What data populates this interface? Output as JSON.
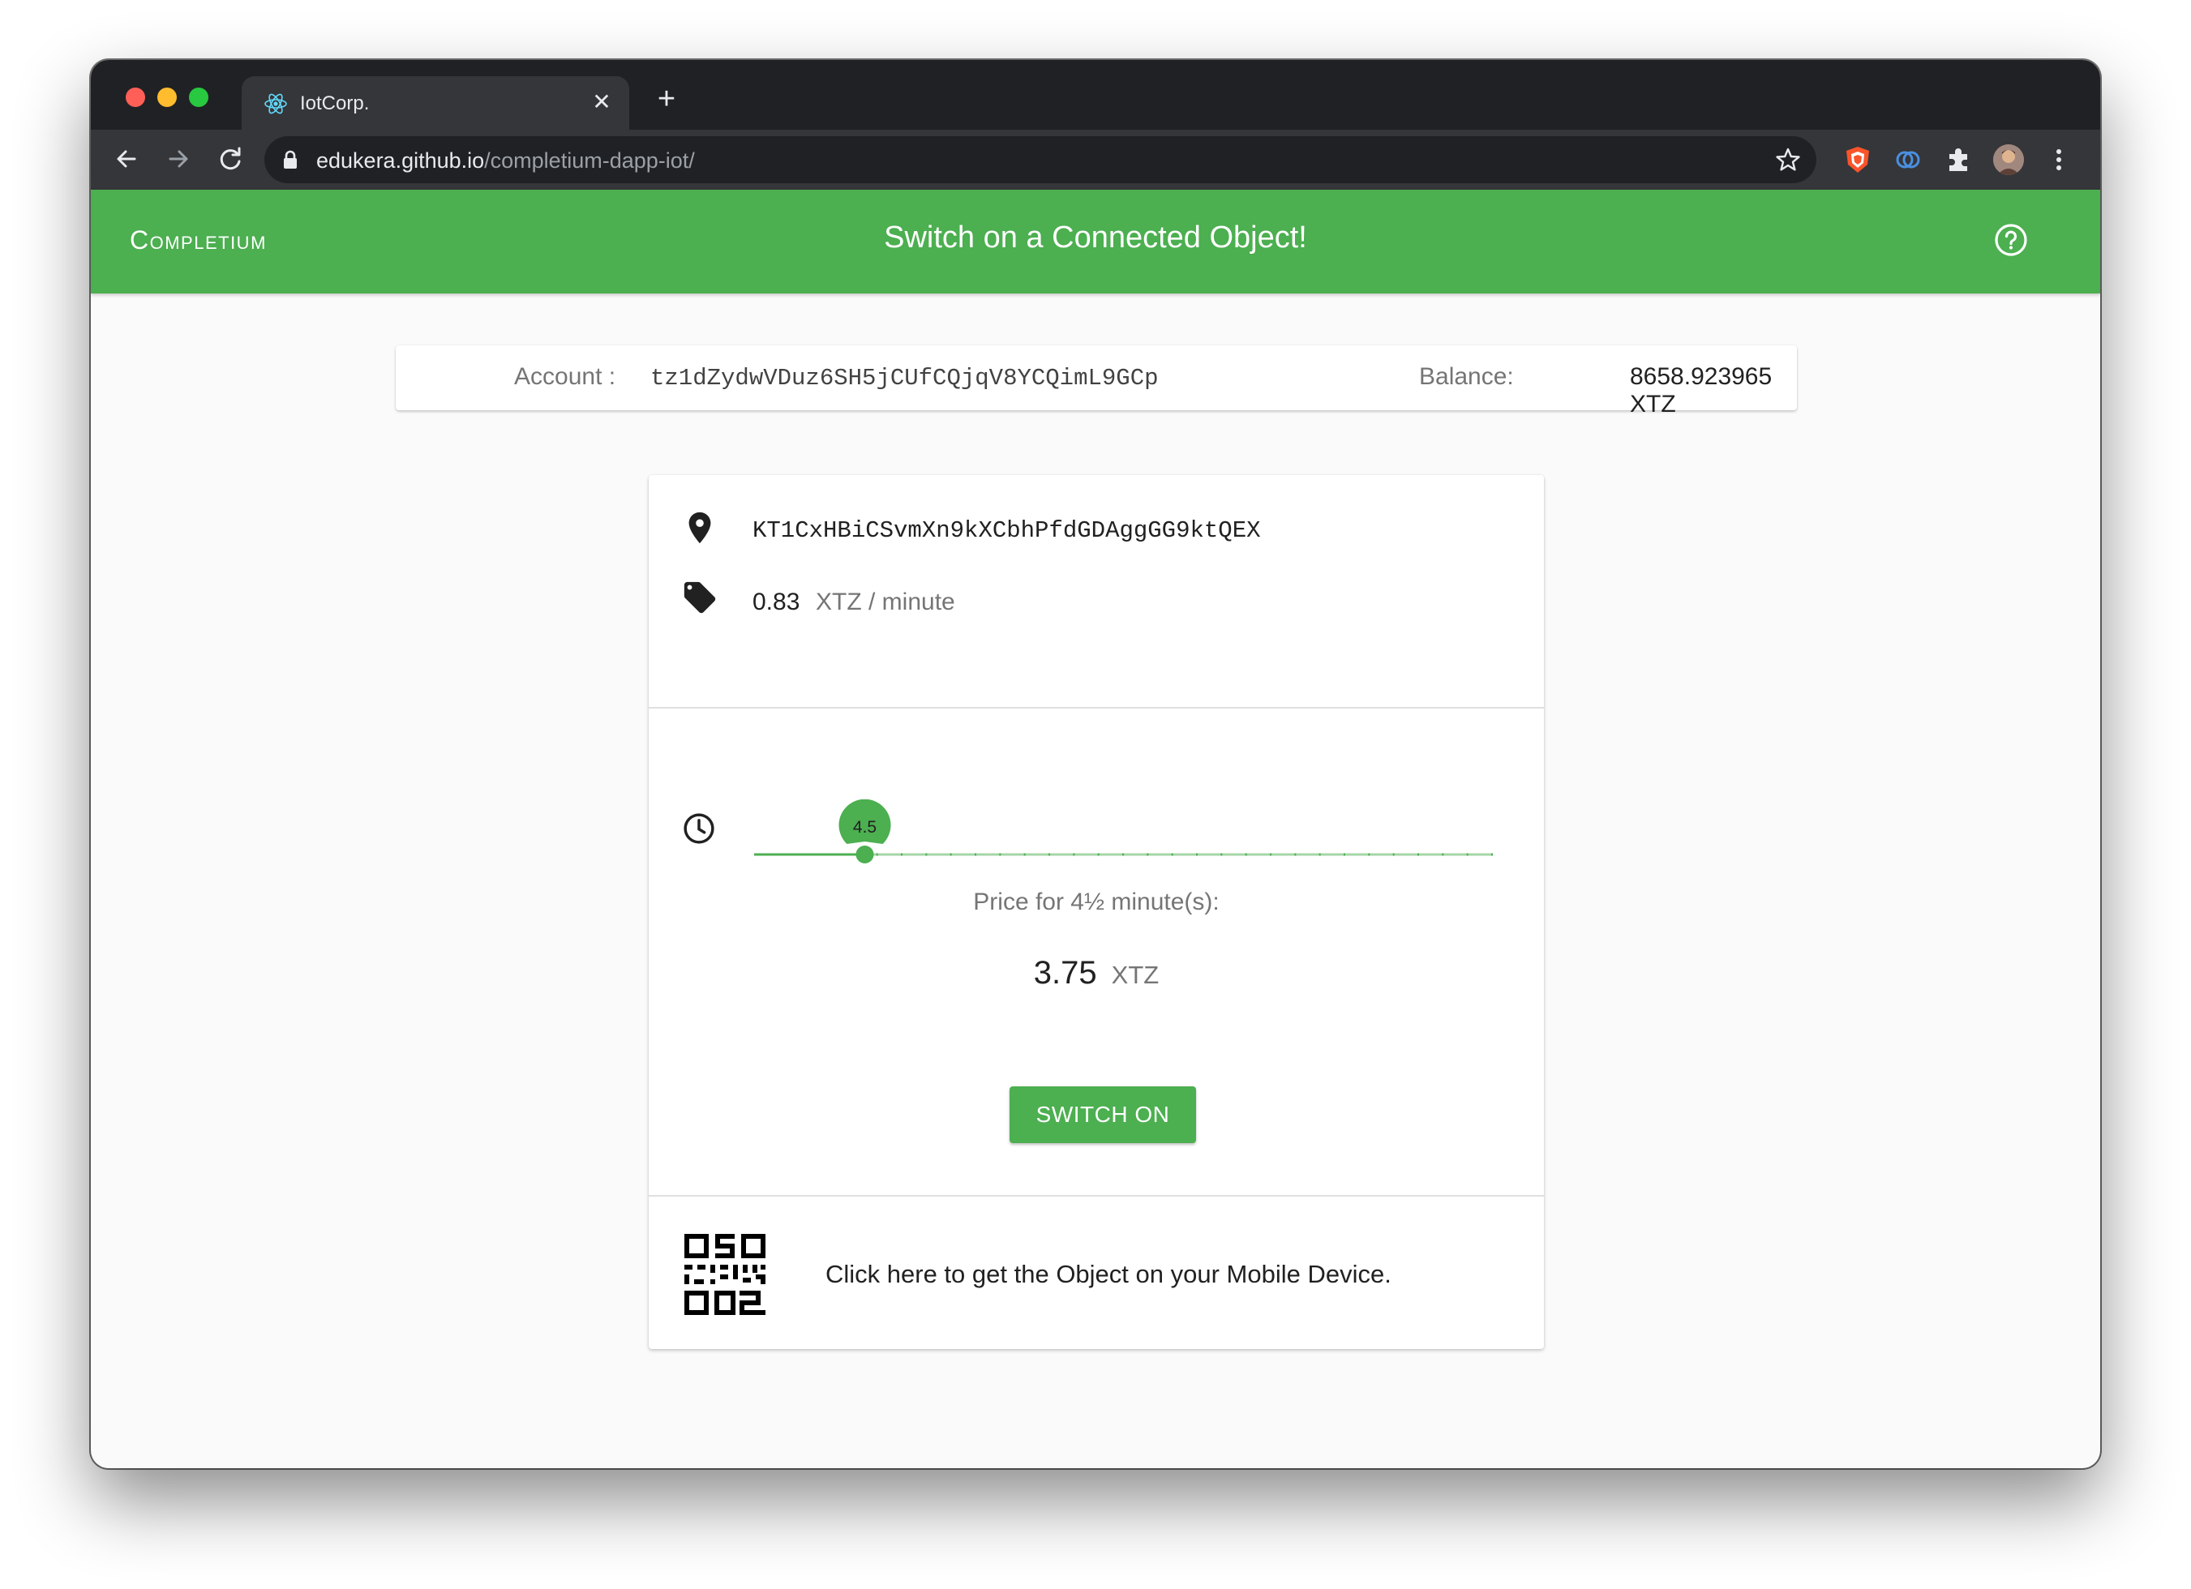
{
  "browser": {
    "tab_title": "IotCorp.",
    "url_host": "edukera.github.io",
    "url_path": "/completium-dapp-iot/"
  },
  "appbar": {
    "brand": "Completium",
    "title": "Switch on a Connected Object!"
  },
  "account": {
    "label": "Account :",
    "address": "tz1dZydwVDuz6SH5jCUfCQjqV8YCQimL9GCp",
    "balance_label": "Balance:",
    "balance_value": "8658.923965 XTZ"
  },
  "object": {
    "address": "KT1CxHBiCSvmXn9kXCbhPfdGDAggGG9ktQEX",
    "price_value": "0.83",
    "price_unit": "XTZ / minute"
  },
  "duration": {
    "slider_value": 4.5,
    "slider_label": "4.5",
    "slider_min": 0,
    "slider_max": 30,
    "slider_step": 1,
    "price_for_text": "Price for 4½ minute(s):",
    "total_value": "3.75",
    "total_unit": "XTZ"
  },
  "actions": {
    "switch_on_label": "SWITCH ON"
  },
  "mobile": {
    "text": "Click here to get the Object on your Mobile Device."
  },
  "colors": {
    "accent": "#4caf50",
    "accent_light": "#a5d6a7"
  },
  "icons": {
    "location": "location-pin-icon",
    "tag": "price-tag-icon",
    "clock": "clock-icon",
    "qr": "qr-code-icon",
    "help": "help-circle-icon"
  }
}
